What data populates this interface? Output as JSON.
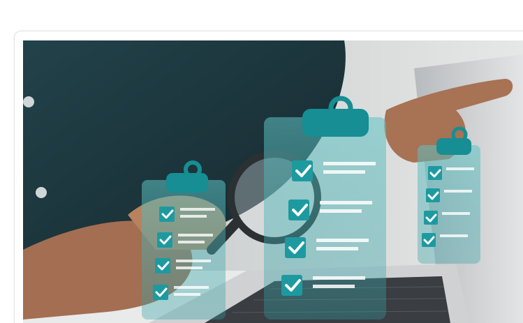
{
  "hero_image": {
    "icon": "checklist-photo-icon",
    "colors": {
      "shirt": "#1f3a40",
      "background": "#d9dcdc",
      "clipboard": "#2a9ea0",
      "clip": "#168e93",
      "check_box": "#1d9aa0",
      "laptop": "#c9cbcd",
      "keyboard": "#3a3d42",
      "skin": "#b07a5c"
    }
  }
}
